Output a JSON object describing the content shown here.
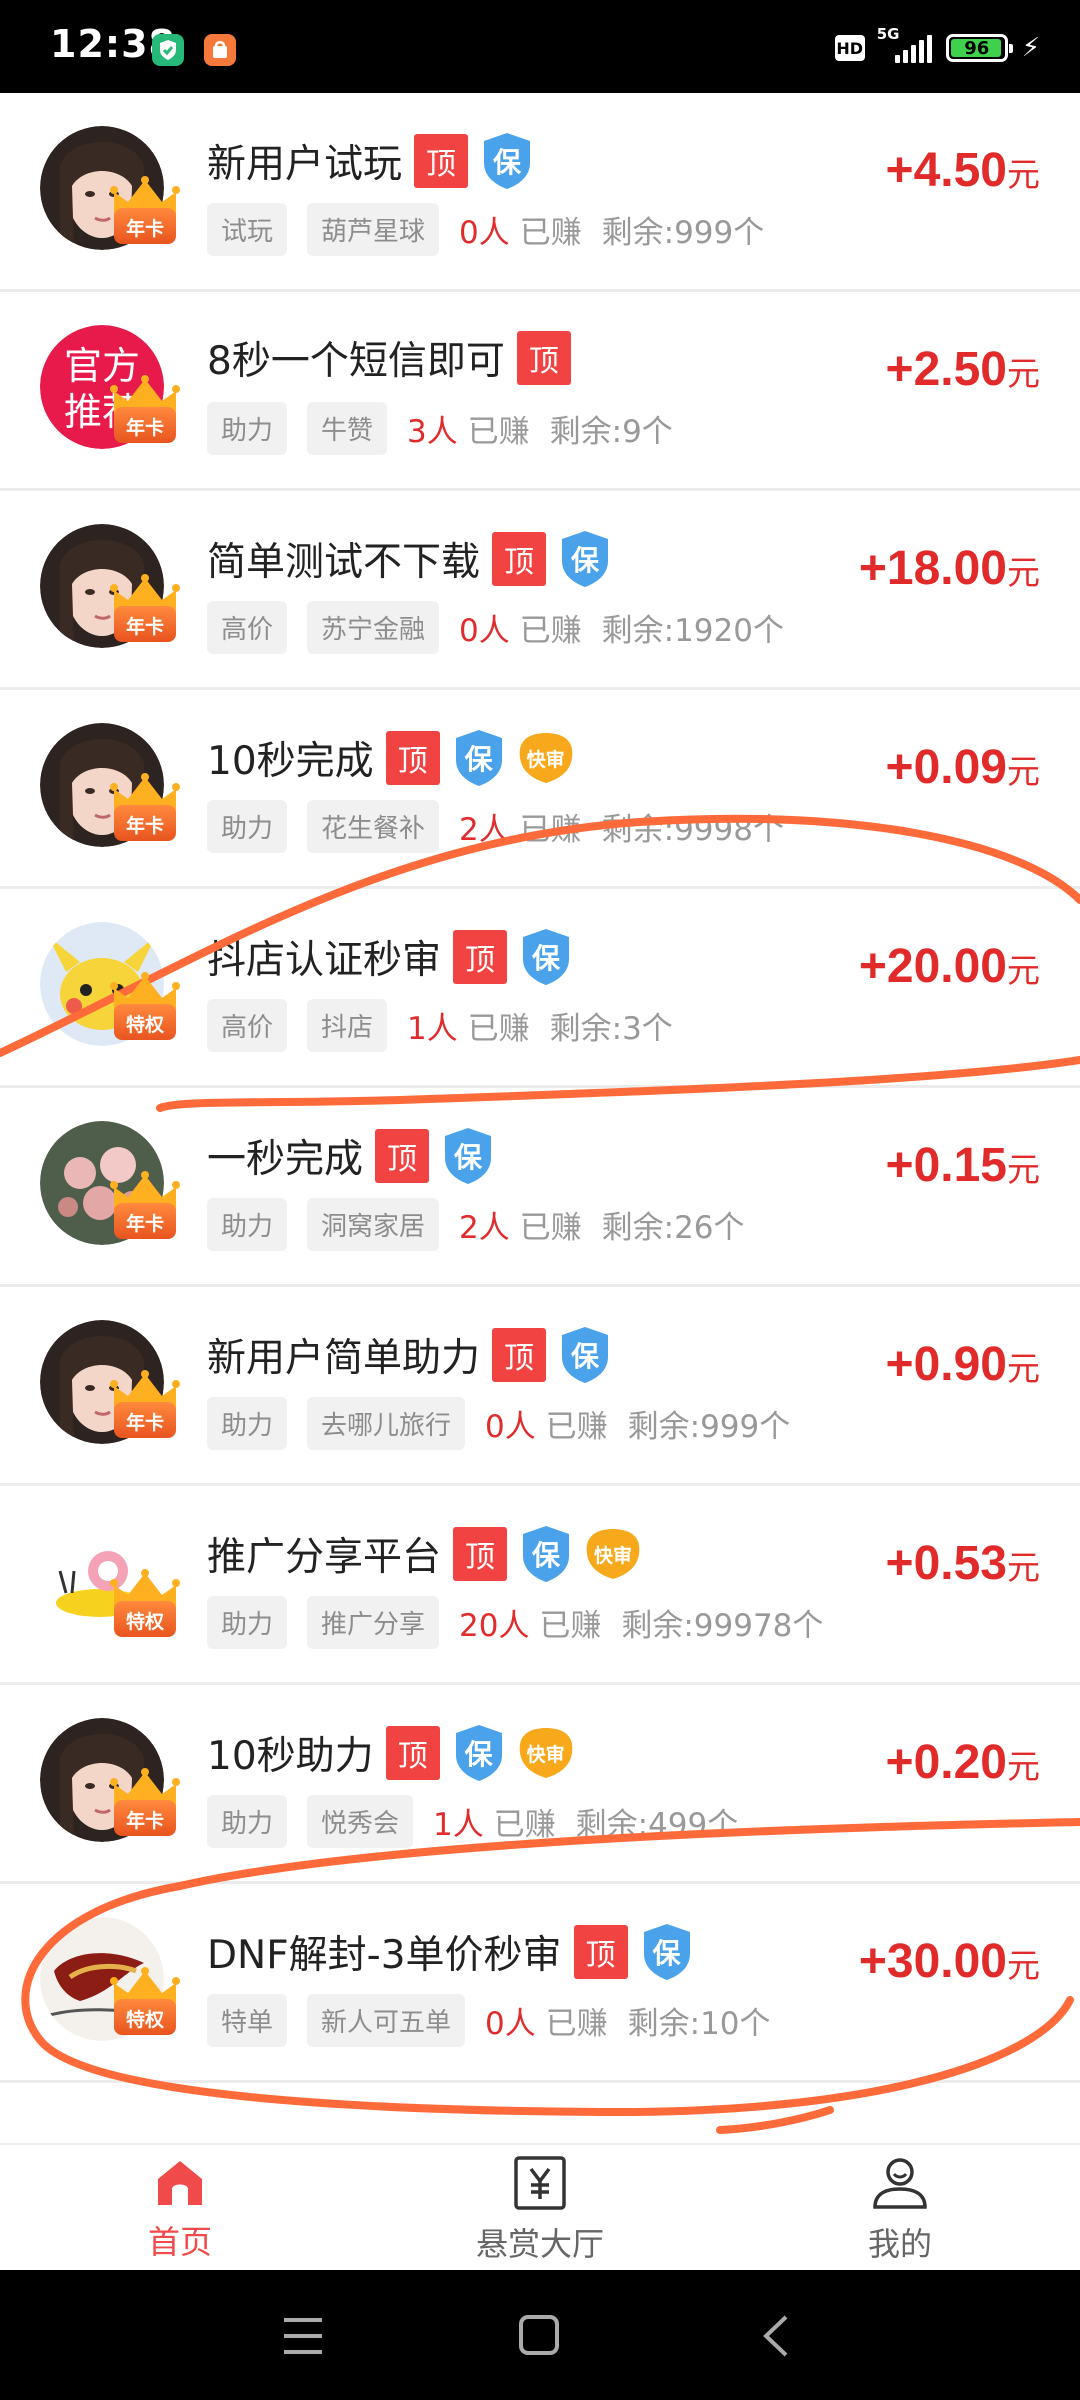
{
  "status_bar": {
    "time": "12:38",
    "hd": "HD",
    "network": "5G",
    "battery": "96",
    "charging": "bolt-icon"
  },
  "tasks": [
    {
      "title": "新用户试玩",
      "badges": [
        "顶",
        "保"
      ],
      "tag1": "试玩",
      "tag2": "葫芦星球",
      "earned_num": "0人",
      "earned_label": "已赚",
      "remain": "剩余:999个",
      "amount": "+4.50",
      "unit": "元",
      "crown": "年卡",
      "avatar": "girl"
    },
    {
      "title": "8秒一个短信即可",
      "badges": [
        "顶"
      ],
      "tag1": "助力",
      "tag2": "牛赞",
      "earned_num": "3人",
      "earned_label": "已赚",
      "remain": "剩余:9个",
      "amount": "+2.50",
      "unit": "元",
      "crown": "年卡",
      "avatar": "official",
      "avatar_text": "官方推荐"
    },
    {
      "title": "简单测试不下载",
      "badges": [
        "顶",
        "保"
      ],
      "tag1": "高价",
      "tag2": "苏宁金融",
      "earned_num": "0人",
      "earned_label": "已赚",
      "remain": "剩余:1920个",
      "amount": "+18.00",
      "unit": "元",
      "crown": "年卡",
      "avatar": "girl"
    },
    {
      "title": "10秒完成",
      "badges": [
        "顶",
        "保",
        "快审"
      ],
      "tag1": "助力",
      "tag2": "花生餐补",
      "earned_num": "2人",
      "earned_label": "已赚",
      "remain": "剩余:9998个",
      "amount": "+0.09",
      "unit": "元",
      "crown": "年卡",
      "avatar": "girl"
    },
    {
      "title": "抖店认证秒审",
      "badges": [
        "顶",
        "保"
      ],
      "tag1": "高价",
      "tag2": "抖店",
      "earned_num": "1人",
      "earned_label": "已赚",
      "remain": "剩余:3个",
      "amount": "+20.00",
      "unit": "元",
      "crown": "特权",
      "avatar": "pikachu"
    },
    {
      "title": "一秒完成",
      "badges": [
        "顶",
        "保"
      ],
      "tag1": "助力",
      "tag2": "洞窝家居",
      "earned_num": "2人",
      "earned_label": "已赚",
      "remain": "剩余:26个",
      "amount": "+0.15",
      "unit": "元",
      "crown": "年卡",
      "avatar": "flowers"
    },
    {
      "title": "新用户简单助力",
      "badges": [
        "顶",
        "保"
      ],
      "tag1": "助力",
      "tag2": "去哪儿旅行",
      "earned_num": "0人",
      "earned_label": "已赚",
      "remain": "剩余:999个",
      "amount": "+0.90",
      "unit": "元",
      "crown": "年卡",
      "avatar": "girl"
    },
    {
      "title": "推广分享平台",
      "badges": [
        "顶",
        "保",
        "快审"
      ],
      "tag1": "助力",
      "tag2": "推广分享",
      "earned_num": "20人",
      "earned_label": "已赚",
      "remain": "剩余:99978个",
      "amount": "+0.53",
      "unit": "元",
      "crown": "特权",
      "avatar": "snail"
    },
    {
      "title": "10秒助力",
      "badges": [
        "顶",
        "保",
        "快审"
      ],
      "tag1": "助力",
      "tag2": "悦秀会",
      "earned_num": "1人",
      "earned_label": "已赚",
      "remain": "剩余:499个",
      "amount": "+0.20",
      "unit": "元",
      "crown": "年卡",
      "avatar": "girl"
    },
    {
      "title": "DNF解封-3单价秒审",
      "badges": [
        "顶",
        "保"
      ],
      "tag1": "特单",
      "tag2": "新人可五单",
      "earned_num": "0人",
      "earned_label": "已赚",
      "remain": "剩余:10个",
      "amount": "+30.00",
      "unit": "元",
      "crown": "特权",
      "avatar": "dnf"
    }
  ],
  "bottom_nav": {
    "home": "首页",
    "hall": "悬赏大厅",
    "mine": "我的"
  },
  "colors": {
    "accent_red": "#e12b2b",
    "nav_active": "#f04a4a",
    "annotation_orange": "#ff6a3a"
  }
}
